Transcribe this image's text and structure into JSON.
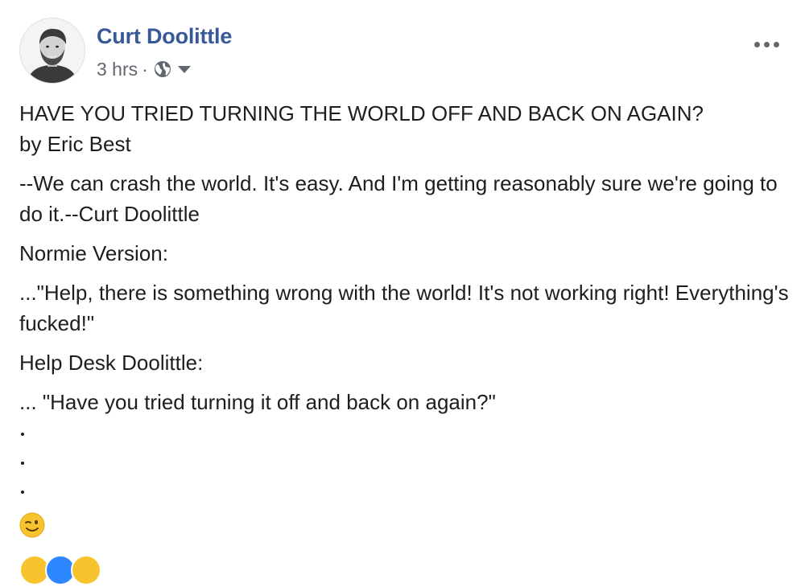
{
  "post": {
    "author": "Curt Doolittle",
    "timestamp": "3 hrs",
    "separator": "·",
    "privacy_icon": "globe-icon",
    "audience_dropdown_icon": "caret-down-icon",
    "more_options_icon": "more-horizontal-icon",
    "paragraphs": [
      "HAVE YOU TRIED TURNING THE WORLD OFF AND BACK ON AGAIN?\nby Eric Best",
      "--We can crash the world. It's easy. And I'm getting reasonably sure we're going to do it.--Curt Doolittle",
      "Normie Version:",
      "...\"Help, there is something wrong with the world! It's not working right! Everything's fucked!\"",
      "Help Desk Doolittle:",
      "... \"Have you tried turning it off and back on again?\""
    ],
    "trailing_dots": [
      ".",
      ".",
      "."
    ],
    "emoji": "winking-face-emoji",
    "reactions": [
      "haha-reaction",
      "like-reaction",
      "wow-reaction"
    ]
  },
  "colors": {
    "author_link": "#385898",
    "meta_text": "#616770",
    "body_text": "#1c1e21",
    "icon_gray": "#606770"
  }
}
